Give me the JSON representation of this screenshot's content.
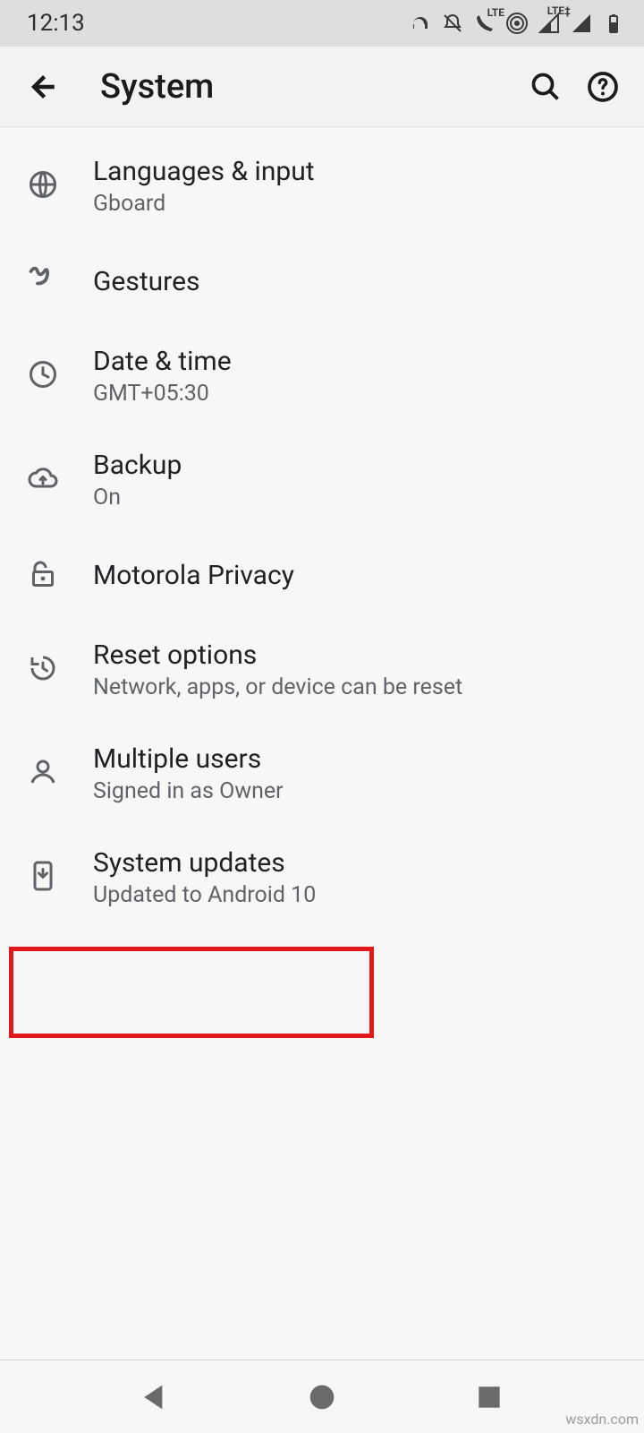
{
  "status": {
    "time": "12:13",
    "lte_label": "LTE",
    "lte_plus": "LTE‡"
  },
  "appbar": {
    "title": "System"
  },
  "rows": {
    "lang": {
      "title": "Languages & input",
      "sub": "Gboard"
    },
    "gestures": {
      "title": "Gestures"
    },
    "datetime": {
      "title": "Date & time",
      "sub": "GMT+05:30"
    },
    "backup": {
      "title": "Backup",
      "sub": "On"
    },
    "privacy": {
      "title": "Motorola Privacy"
    },
    "reset": {
      "title": "Reset options",
      "sub": "Network, apps, or device can be reset"
    },
    "users": {
      "title": "Multiple users",
      "sub": "Signed in as Owner"
    },
    "updates": {
      "title": "System updates",
      "sub": "Updated to Android 10"
    }
  },
  "watermark": "wsxdn.com"
}
